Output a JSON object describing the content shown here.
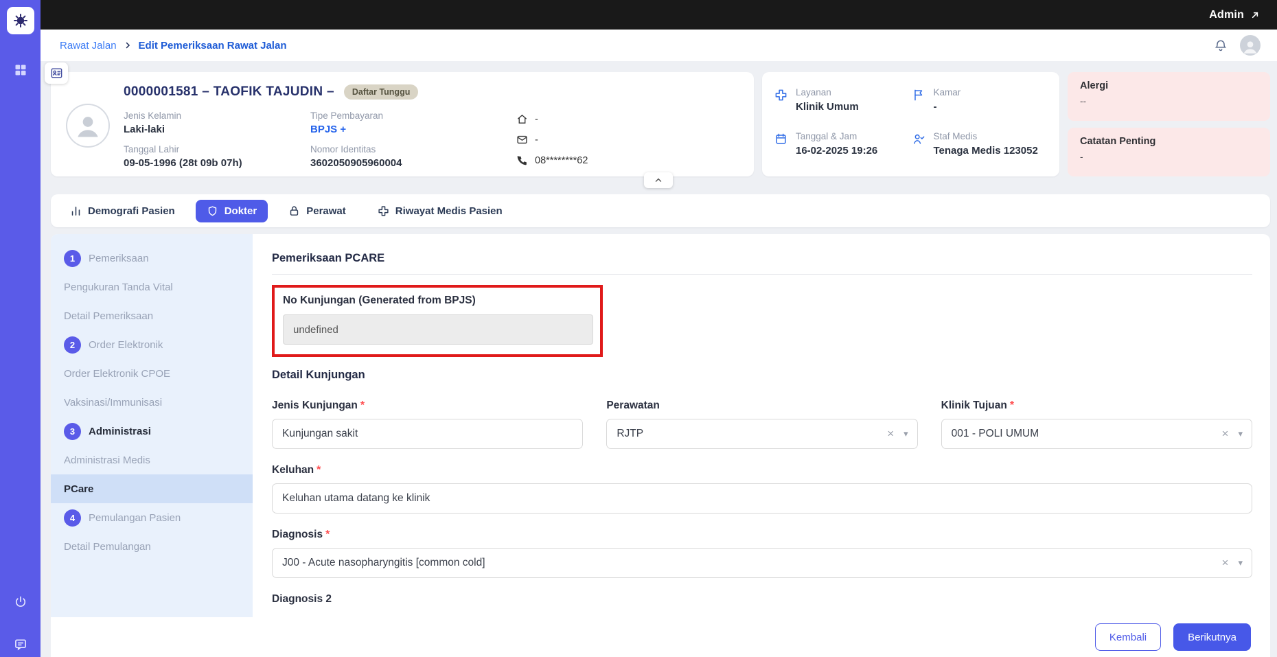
{
  "topbar": {
    "admin_label": "Admin"
  },
  "breadcrumb": {
    "parent": "Rawat Jalan",
    "current": "Edit Pemeriksaan Rawat Jalan"
  },
  "patient": {
    "title": "0000001581 – TAOFIK TAJUDIN –",
    "status_badge": "Daftar Tunggu",
    "jenis_kelamin_label": "Jenis Kelamin",
    "jenis_kelamin": "Laki-laki",
    "tanggal_lahir_label": "Tanggal Lahir",
    "tanggal_lahir": "09-05-1996 (28t 09b 07h)",
    "tipe_pembayaran_label": "Tipe Pembayaran",
    "tipe_pembayaran": "BPJS +",
    "nomor_identitas_label": "Nomor Identitas",
    "nomor_identitas": "3602050905960004",
    "address_value": "-",
    "email_value": "-",
    "phone_value": "08********62"
  },
  "service": {
    "layanan_label": "Layanan",
    "layanan_value": "Klinik Umum",
    "kamar_label": "Kamar",
    "kamar_value": "-",
    "tanggal_label": "Tanggal & Jam",
    "tanggal_value": "16-02-2025 19:26",
    "staf_label": "Staf Medis",
    "staf_value": "Tenaga Medis 123052"
  },
  "alerts": {
    "alergi_label": "Alergi",
    "alergi_value": "--",
    "catatan_label": "Catatan Penting",
    "catatan_value": "-"
  },
  "tabs": [
    {
      "label": "Demografi Pasien"
    },
    {
      "label": "Dokter"
    },
    {
      "label": "Perawat"
    },
    {
      "label": "Riwayat Medis Pasien"
    }
  ],
  "nav": {
    "items": [
      {
        "num": "1",
        "label": "Pemeriksaan"
      },
      {
        "label": "Pengukuran Tanda Vital"
      },
      {
        "label": "Detail Pemeriksaan"
      },
      {
        "num": "2",
        "label": "Order Elektronik"
      },
      {
        "label": "Order Elektronik CPOE"
      },
      {
        "label": "Vaksinasi/Immunisasi"
      },
      {
        "num": "3",
        "label": "Administrasi"
      },
      {
        "label": "Administrasi Medis"
      },
      {
        "label": "PCare"
      },
      {
        "num": "4",
        "label": "Pemulangan Pasien"
      },
      {
        "label": "Detail Pemulangan"
      }
    ]
  },
  "form": {
    "section_title": "Pemeriksaan PCARE",
    "no_kunjungan_label": "No Kunjungan (Generated from BPJS)",
    "no_kunjungan_value": "undefined",
    "detail_section_title": "Detail Kunjungan",
    "required_marker": "*",
    "jenis_kunjungan_label": "Jenis Kunjungan",
    "jenis_kunjungan_value": "Kunjungan sakit",
    "perawatan_label": "Perawatan",
    "perawatan_value": "RJTP",
    "klinik_tujuan_label": "Klinik Tujuan",
    "klinik_tujuan_value": "001 - POLI UMUM",
    "keluhan_label": "Keluhan",
    "keluhan_value": "Keluhan utama datang ke klinik",
    "diagnosis_label": "Diagnosis",
    "diagnosis_value": "J00 - Acute nasopharyngitis [common cold]",
    "diagnosis2_label": "Diagnosis 2"
  },
  "footer": {
    "back_label": "Kembali",
    "next_label": "Berikutnya"
  },
  "icons": {
    "clear_glyph": "×",
    "caret_glyph": "▾"
  },
  "colors": {
    "sidebar": "#5a5be8",
    "topbar": "#191919",
    "accent": "#4f5be8",
    "link_blue": "#2563eb",
    "annotation_red": "#e01a1a",
    "alert_pink": "#fce8e8",
    "nav_bg": "#e9f1fc",
    "nav_selected": "#cfdff7",
    "badge_bg": "#d9d4c5"
  }
}
